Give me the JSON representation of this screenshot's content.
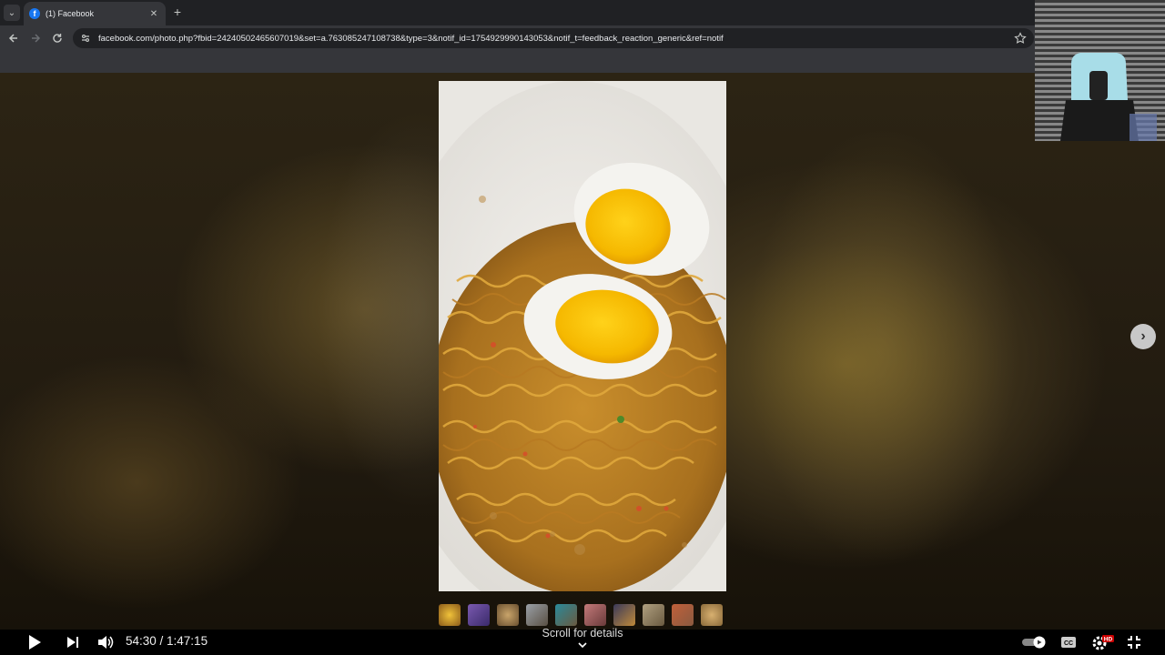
{
  "browser": {
    "tab": {
      "title": "(1) Facebook",
      "favicon": "facebook-icon"
    },
    "url": "facebook.com/photo.php?fbid=24240502465607019&set=a.763085247108738&type=3&notif_id=1754929990143053&notif_t=feedback_reaction_generic&ref=notif"
  },
  "photo": {
    "subject": "noodles-with-boiled-eggs",
    "thumbnail_count": 10
  },
  "video_player": {
    "current_time": "54:30",
    "duration": "1:47:15",
    "time_display": "54:30 / 1:47:15",
    "scroll_hint": "Scroll for details",
    "hd_badge": "HD",
    "icons": [
      "play-icon",
      "next-icon",
      "volume-icon",
      "autoplay-toggle-icon",
      "captions-icon",
      "settings-icon",
      "exit-fullscreen-icon"
    ]
  },
  "colors": {
    "chrome_dark": "#202124",
    "chrome_toolbar": "#35363a",
    "facebook_blue": "#1877f2",
    "hd_badge_red": "#cc0000"
  }
}
